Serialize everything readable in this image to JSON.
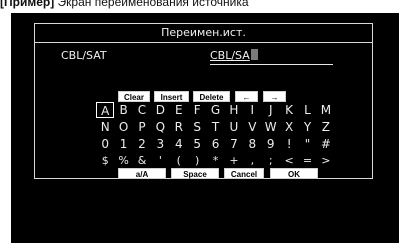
{
  "caption": {
    "bold": "[Пример]",
    "text": " Экран переименования источника"
  },
  "dialog": {
    "title": "Переимен.ист.",
    "source_label": "CBL/SAT",
    "name_value": "CBL/SA",
    "caret_char": "T"
  },
  "top_buttons": [
    "Clear",
    "Insert",
    "Delete",
    "←",
    "→"
  ],
  "keyboard": {
    "rows": [
      [
        "A",
        "B",
        "C",
        "D",
        "E",
        "F",
        "G",
        "H",
        "I",
        "J",
        "K",
        "L",
        "M"
      ],
      [
        "N",
        "O",
        "P",
        "Q",
        "R",
        "S",
        "T",
        "U",
        "V",
        "W",
        "X",
        "Y",
        "Z"
      ],
      [
        "0",
        "1",
        "2",
        "3",
        "4",
        "5",
        "6",
        "7",
        "8",
        "9",
        "!",
        "\"",
        "#"
      ],
      [
        "$",
        "%",
        "&",
        "'",
        "(",
        ")",
        "*",
        "+",
        ",",
        ";",
        "<",
        "=",
        ">"
      ]
    ],
    "selected": "A"
  },
  "bottom_buttons": [
    "a/A",
    "Space",
    "Cancel",
    "OK"
  ]
}
